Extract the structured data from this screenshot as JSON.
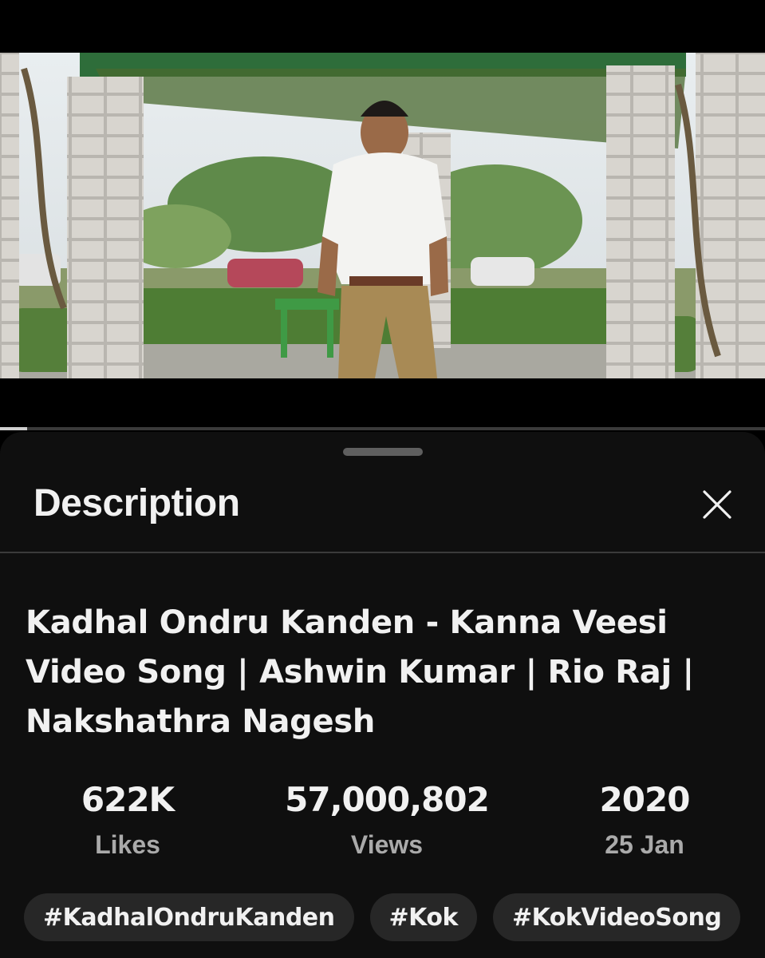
{
  "player": {
    "progress_fraction": 0.035
  },
  "sheet": {
    "title": "Description",
    "close_icon": "close-icon"
  },
  "video": {
    "title": "Kadhal Ondru Kanden - Kanna Veesi Video Song | Ashwin Kumar | Rio Raj | Nakshathra Nagesh"
  },
  "stats": {
    "likes": {
      "value": "622K",
      "label": "Likes"
    },
    "views": {
      "value": "57,000,802",
      "label": "Views"
    },
    "date": {
      "value": "2020",
      "label": "25 Jan"
    }
  },
  "hashtags": [
    "#KadhalOndruKanden",
    "#Kok",
    "#KokVideoSong"
  ],
  "colors": {
    "sheet_bg": "#0f0f0f",
    "chip_bg": "#272727",
    "secondary_text": "#aaaaaa"
  }
}
